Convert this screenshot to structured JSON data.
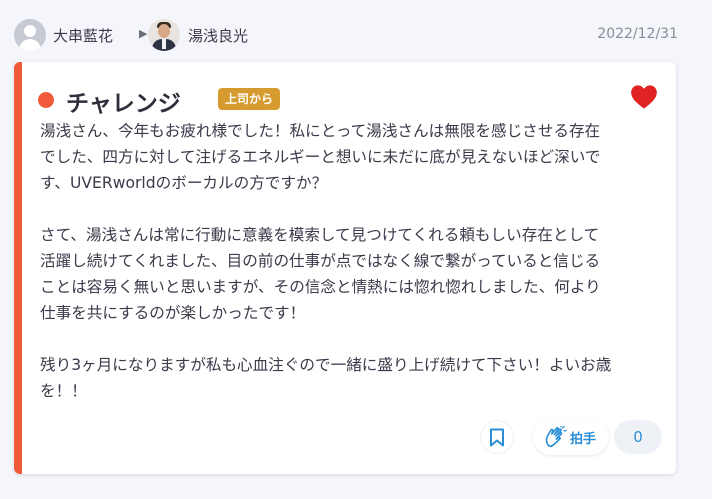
{
  "header": {
    "sender": "大串藍花",
    "receiver": "湯浅良光",
    "date": "2022/12/31",
    "arrow": "▶"
  },
  "card": {
    "category": "チャレンジ",
    "badge": "上司から",
    "accent_color": "#f25a3c",
    "badge_color": "#d69b2e",
    "message": "湯浅さん、今年もお疲れ様でした！私にとって湯浅さんは無限を感じさせる存在\nでした、四方に対して注げるエネルギーと想いに未だに底が見えないほど深いで\nす、UVERworldのボーカルの方ですか？\n\nさて、湯浅さんは常に行動に意義を模索して見つけてくれる頼もしい存在として\n活躍し続けてくれました、目の前の仕事が点ではなく線で繋がっていると信じる\nことは容易く無いと思いますが、その信念と情熱には惚れ惚れしました、何より\n仕事を共にするのが楽しかったです！\n\n残り3ヶ月になりますが私も心血注ぐので一緒に盛り上げ続けて下さい！よいお歳\nを！！",
    "icons": {
      "like": "heart-icon",
      "bookmark": "bookmark-icon",
      "applause": "clap-icon"
    },
    "actions": {
      "applause_label": "拍手",
      "applause_count": "0"
    }
  }
}
